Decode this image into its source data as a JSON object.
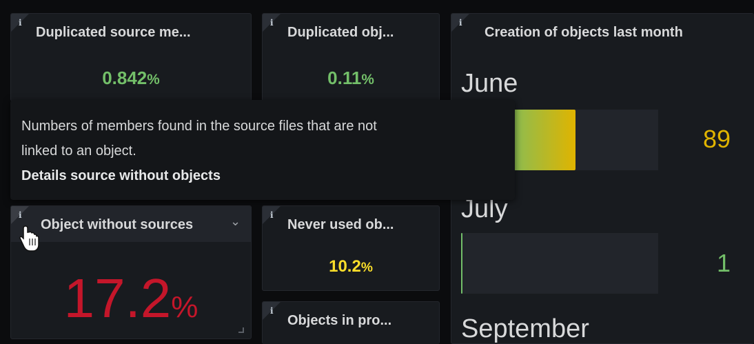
{
  "panels": {
    "dup_source": {
      "title": "Duplicated source me...",
      "value": "0.842",
      "unit": "%",
      "color": "#73bf69",
      "info": "i"
    },
    "dup_obj": {
      "title": "Duplicated obj...",
      "value": "0.11",
      "unit": "%",
      "color": "#73bf69",
      "info": "i"
    },
    "obj_without_sources": {
      "title": "Object without sources",
      "value": "17.2",
      "unit": "%",
      "color": "#c4162a",
      "info": "i",
      "menu": "⌄"
    },
    "never_used": {
      "title": "Never used ob...",
      "value": "10.2",
      "unit": "%",
      "color": "#fade2a",
      "info": "i"
    },
    "objects_in_pro": {
      "title": "Objects in pro...",
      "info": "i"
    },
    "creation": {
      "title": "Creation of objects last month",
      "info": "i",
      "bars": [
        {
          "label": "June",
          "value": "89",
          "fill_fraction": 0.58,
          "color": "#e0b400"
        },
        {
          "label": "July",
          "value": "1",
          "fill_fraction": 0.007,
          "color": "#73bf69"
        },
        {
          "label": "September"
        }
      ]
    }
  },
  "tooltip": {
    "line1": "Numbers of members found in the source files that are not",
    "line2": "linked to an object.",
    "link": "Details source without objects"
  },
  "cursor": "pointer-hand-icon"
}
